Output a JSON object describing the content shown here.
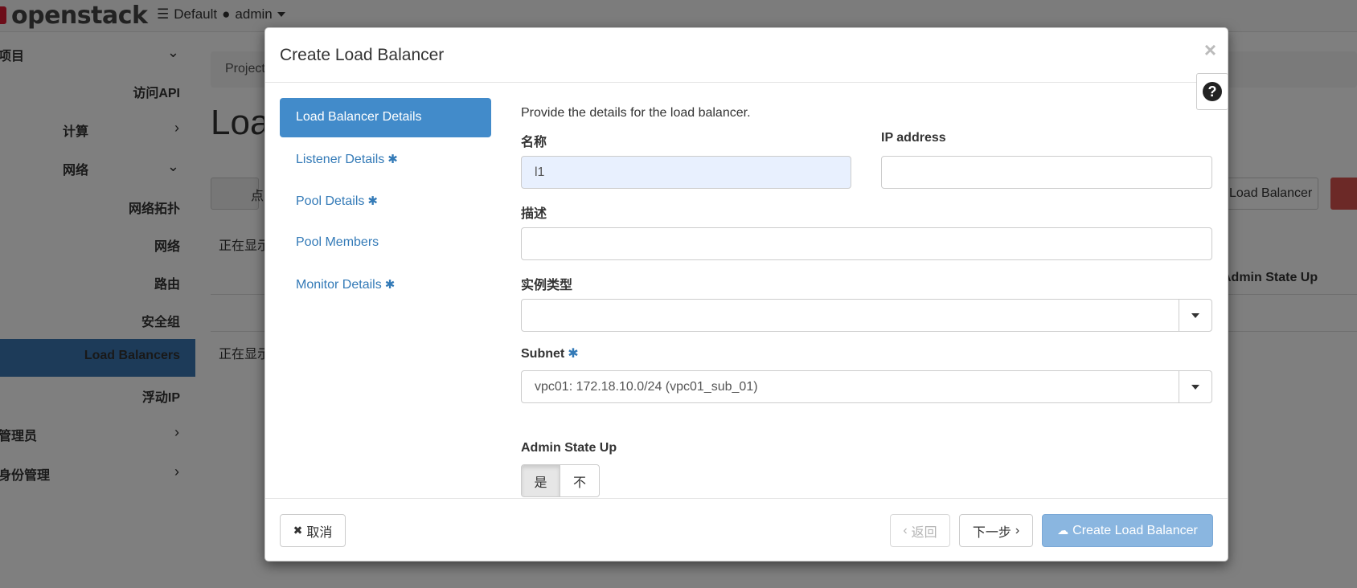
{
  "topbar": {
    "logo_text": "openstack",
    "project_domain": "Default",
    "project_name": "admin"
  },
  "sidebar": {
    "items": [
      {
        "label": "项目"
      },
      {
        "label": "访问API"
      },
      {
        "label": "计算"
      },
      {
        "label": "网络"
      },
      {
        "label": "网络拓扑"
      },
      {
        "label": "网络"
      },
      {
        "label": "路由"
      },
      {
        "label": "安全组"
      },
      {
        "label": "Load Balancers"
      },
      {
        "label": "浮动IP"
      },
      {
        "label": "管理员"
      },
      {
        "label": "身份管理"
      }
    ]
  },
  "background": {
    "breadcrumb": "Project",
    "page_title": "Load Balancers",
    "search_placeholder": "点",
    "create_button": "Load Balancer",
    "showing_top": "正在显示",
    "showing_bottom": "正在显示",
    "col_admin_state": "Admin State Up"
  },
  "modal": {
    "title": "Create Load Balancer",
    "close_glyph": "×",
    "help_glyph": "?",
    "steps": [
      {
        "label": "Load Balancer Details",
        "required": false,
        "active": true
      },
      {
        "label": "Listener Details",
        "required": true,
        "active": false
      },
      {
        "label": "Pool Details",
        "required": true,
        "active": false
      },
      {
        "label": "Pool Members",
        "required": false,
        "active": false
      },
      {
        "label": "Monitor Details",
        "required": true,
        "active": false
      }
    ],
    "required_mark": "✱",
    "form": {
      "help_text": "Provide the details for the load balancer.",
      "name_label": "名称",
      "name_value": "l1",
      "ip_label": "IP address",
      "ip_value": "",
      "description_label": "描述",
      "description_value": "",
      "flavor_label": "实例类型",
      "flavor_value": "",
      "subnet_label": "Subnet",
      "subnet_value": "vpc01: 172.18.10.0/24 (vpc01_sub_01)",
      "admin_state_label": "Admin State Up",
      "admin_state_yes": "是",
      "admin_state_no": "不"
    },
    "footer": {
      "cancel_label": "取消",
      "back_label": "返回",
      "next_label": "下一步",
      "create_label": "Create Load Balancer"
    }
  },
  "colors": {
    "accent": "#337ab7",
    "active_step": "#428bca",
    "sidebar_active": "#3b76b2",
    "primary_disabled": "#8ab6e0"
  }
}
